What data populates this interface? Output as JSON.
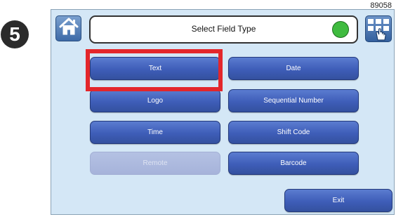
{
  "figure_number": "89058",
  "step_number": "5",
  "header": {
    "title": "Select Field Type",
    "home_icon": "home-icon",
    "keypad_icon": "keypad-touch-icon",
    "status_color": "#3fbb3f"
  },
  "buttons": {
    "text": "Text",
    "date": "Date",
    "logo": "Logo",
    "sequential_number": "Sequential Number",
    "time": "Time",
    "shift_code": "Shift Code",
    "remote": "Remote",
    "barcode": "Barcode",
    "exit": "Exit"
  },
  "colors": {
    "button_blue": "#3e5db8",
    "button_disabled": "#aab6dc",
    "screen_background": "#d4e7f6",
    "highlight_red": "#e3262b"
  }
}
